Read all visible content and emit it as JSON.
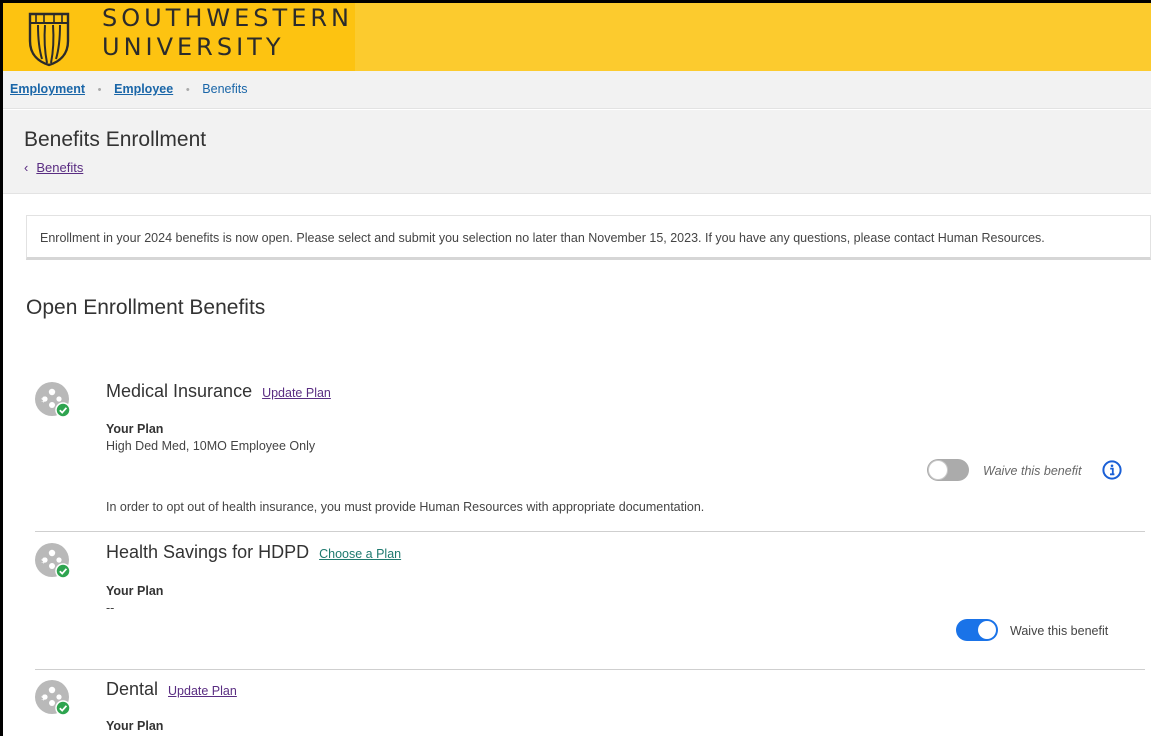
{
  "brand": {
    "line1": "SOUTHWESTERN",
    "line2": "UNIVERSITY",
    "colors": {
      "banner": "#fccb2e",
      "logo_bg": "#fdc311"
    }
  },
  "breadcrumb": {
    "items": [
      "Employment",
      "Employee"
    ],
    "current": "Benefits"
  },
  "header": {
    "title": "Benefits Enrollment",
    "back_label": "Benefits"
  },
  "notice": {
    "text": "Enrollment in your 2024 benefits is now open. Please select and submit you selection no later than November 15, 2023. If you have any questions, please contact Human Resources."
  },
  "section": {
    "title": "Open Enrollment Benefits"
  },
  "benefits": [
    {
      "name": "Medical Insurance",
      "action_label": "Update Plan",
      "plan_label": "Your Plan",
      "plan_value": "High Ded Med, 10MO Employee Only",
      "waive_label": "Waive this benefit",
      "waived": false,
      "toggle_disabled": true,
      "note": "In order to opt out of health insurance, you must provide Human Resources with appropriate documentation.",
      "icon": "benefit-status-icon"
    },
    {
      "name": "Health Savings for HDPD",
      "action_label": "Choose a Plan",
      "plan_label": "Your Plan",
      "plan_value": "--",
      "waive_label": "Waive this benefit",
      "waived": true,
      "icon": "benefit-status-icon"
    },
    {
      "name": "Dental",
      "action_label": "Update Plan",
      "plan_label": "Your Plan",
      "icon": "benefit-status-icon"
    }
  ],
  "colors": {
    "link_purple": "#5a2d82",
    "link_blue": "#1a66a8",
    "link_green": "#1f7a6f",
    "toggle_on": "#1a73e8",
    "status_check": "#2ea44f"
  }
}
